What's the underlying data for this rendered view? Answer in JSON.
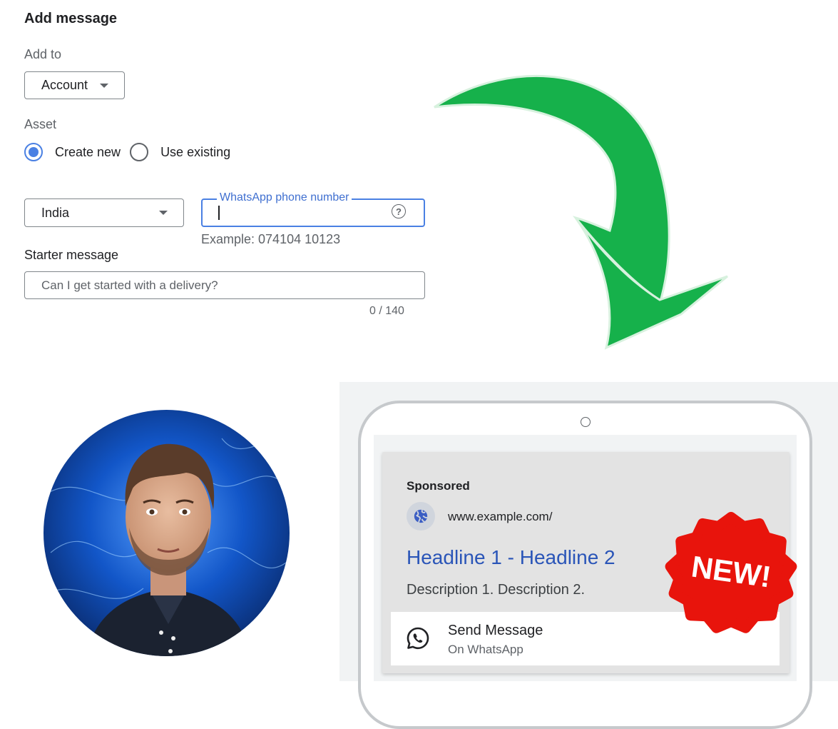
{
  "form": {
    "title": "Add message",
    "add_to_label": "Add to",
    "add_to_value": "Account",
    "asset_label": "Asset",
    "radio_create": "Create new",
    "radio_existing": "Use existing",
    "country_value": "India",
    "phone_label": "WhatsApp phone number",
    "phone_value": "",
    "help_glyph": "?",
    "phone_hint": "Example: 074104 10123",
    "starter_label": "Starter message",
    "starter_placeholder": "Can I get started with a delivery?",
    "char_count": "0 / 140"
  },
  "ad": {
    "sponsored": "Sponsored",
    "url": "www.example.com/",
    "headline": "Headline 1 - Headline 2",
    "description": "Description 1. Description 2.",
    "send_title": "Send Message",
    "send_subtitle": "On WhatsApp"
  },
  "badge": {
    "text": "NEW!",
    "color": "#e8140c"
  },
  "colors": {
    "accent_blue": "#4a80e3",
    "headline_blue": "#2a55b8",
    "arrow_green": "#16b14b"
  },
  "icons": [
    "caret-down-icon",
    "help-circle-icon",
    "globe-icon",
    "whatsapp-icon",
    "curved-arrow-icon"
  ]
}
